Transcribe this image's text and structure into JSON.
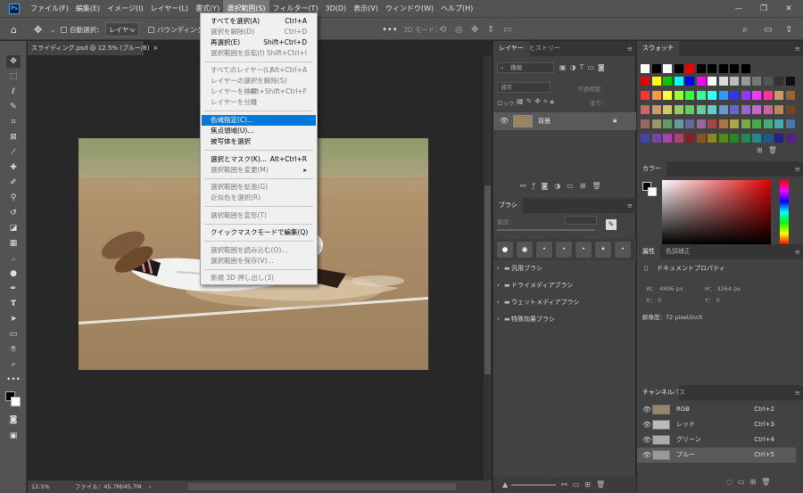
{
  "app": {
    "logo": "Ps"
  },
  "menubar": {
    "items": [
      "ファイル(F)",
      "編集(E)",
      "イメージ(I)",
      "レイヤー(L)",
      "書式(Y)",
      "選択範囲(S)",
      "フィルター(T)",
      "3D(D)",
      "表示(V)",
      "ウィンドウ(W)",
      "ヘルプ(H)"
    ],
    "active_index": 5
  },
  "optionsbar": {
    "auto_select_label": "自動選択：",
    "auto_select_value": "レイヤー",
    "bbox_label": "バウンディングボックス",
    "mode_3d_label": "3D モード："
  },
  "document": {
    "tab_title": "スライディング.psd @ 12.5% (ブルー/8)",
    "zoom": "12.5%",
    "file_info": "ファイル：45.7M/45.7M"
  },
  "select_menu": {
    "items": [
      {
        "label": "すべてを選択(A)",
        "shortcut": "Ctrl+A",
        "enabled": true
      },
      {
        "label": "選択を解除(D)",
        "shortcut": "Ctrl+D",
        "enabled": false
      },
      {
        "label": "再選択(E)",
        "shortcut": "Shift+Ctrl+D",
        "enabled": true
      },
      {
        "label": "選択範囲を反転(I)",
        "shortcut": "Shift+Ctrl+I",
        "enabled": false
      },
      {
        "label": "すべてのレイヤー(L)",
        "shortcut": "Alt+Ctrl+A",
        "enabled": false
      },
      {
        "label": "レイヤーの選択を解除(S)",
        "shortcut": "",
        "enabled": false
      },
      {
        "label": "レイヤーを検索",
        "shortcut": "Alt+Shift+Ctrl+F",
        "enabled": false
      },
      {
        "label": "レイヤーを分離",
        "shortcut": "",
        "enabled": false
      },
      {
        "label": "色域指定(C)...",
        "shortcut": "",
        "enabled": true,
        "highlighted": true
      },
      {
        "label": "焦点領域(U)...",
        "shortcut": "",
        "enabled": true
      },
      {
        "label": "被写体を選択",
        "shortcut": "",
        "enabled": true
      },
      {
        "label": "選択とマスク(K)...",
        "shortcut": "Alt+Ctrl+R",
        "enabled": true
      },
      {
        "label": "選択範囲を変更(M)",
        "shortcut": "",
        "enabled": false,
        "submenu": true
      },
      {
        "label": "選択範囲を拡張(G)",
        "shortcut": "",
        "enabled": false
      },
      {
        "label": "近似色を選択(R)",
        "shortcut": "",
        "enabled": false
      },
      {
        "label": "選択範囲を変形(T)",
        "shortcut": "",
        "enabled": false
      },
      {
        "label": "クイックマスクモードで編集(Q)",
        "shortcut": "",
        "enabled": true
      },
      {
        "label": "選択範囲を読み込む(O)...",
        "shortcut": "",
        "enabled": false
      },
      {
        "label": "選択範囲を保存(V)...",
        "shortcut": "",
        "enabled": false
      },
      {
        "label": "新規 3D 押し出し(3)",
        "shortcut": "",
        "enabled": false
      }
    ]
  },
  "layers_panel": {
    "tabs": [
      "レイヤー",
      "ヒストリー"
    ],
    "filter_label": "種類",
    "blend_mode": "通常",
    "opacity_label": "不透明度：",
    "lock_label": "ロック：",
    "fill_label": "塗り：",
    "layer_name": "背景"
  },
  "brush_panel": {
    "tab": "ブラシ",
    "hardness_label": "直径：",
    "folders": [
      "汎用ブラシ",
      "ドライメディアブラシ",
      "ウェットメディアブラシ",
      "特殊効果ブラシ"
    ]
  },
  "swatches_panel": {
    "tab": "スウォッチ"
  },
  "color_panel": {
    "tab": "カラー"
  },
  "properties_panel": {
    "tabs": [
      "属性",
      "色調補正"
    ],
    "doc_props": "ドキュメントプロパティ",
    "w_label": "W：",
    "w_value": "4896 px",
    "h_label": "H：",
    "h_value": "3264 px",
    "x_label": "X：",
    "x_value": "0",
    "y_label": "Y：",
    "y_value": "0",
    "resolution": "解像度：72 pixel/inch"
  },
  "channels_panel": {
    "tabs": [
      "チャンネル",
      "パス"
    ],
    "channels": [
      {
        "name": "RGB",
        "shortcut": "Ctrl+2"
      },
      {
        "name": "レッド",
        "shortcut": "Ctrl+3"
      },
      {
        "name": "グリーン",
        "shortcut": "Ctrl+4"
      },
      {
        "name": "ブルー",
        "shortcut": "Ctrl+5"
      }
    ]
  }
}
